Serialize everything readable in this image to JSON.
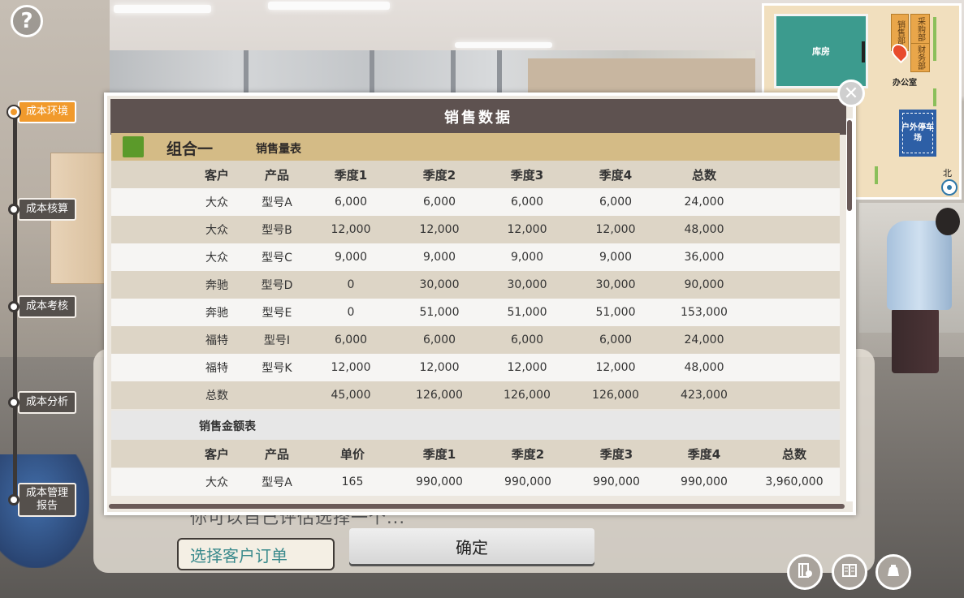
{
  "help": {
    "icon": "?"
  },
  "progress_steps": [
    {
      "label": "成本环境",
      "active": true
    },
    {
      "label": "成本核算",
      "active": false
    },
    {
      "label": "成本考核",
      "active": false
    },
    {
      "label": "成本分析",
      "active": false
    },
    {
      "label_line1": "成本管理",
      "label_line2": "报告",
      "active": false
    }
  ],
  "minimap": {
    "storage": "库房",
    "sales_dept": "销售部",
    "purchase_dept": "采购部",
    "finance_dept": "财务部",
    "office": "办公室",
    "parking": "户外停车场",
    "north": "北"
  },
  "modal": {
    "title": "销售数据",
    "close_icon": "✕",
    "group_name": "组合一",
    "group_color": "#5b9a2a",
    "volume_table": {
      "title": "销售量表",
      "headers": [
        "客户",
        "产品",
        "季度1",
        "季度2",
        "季度3",
        "季度4",
        "总数"
      ],
      "rows": [
        [
          "大众",
          "型号A",
          "6,000",
          "6,000",
          "6,000",
          "6,000",
          "24,000"
        ],
        [
          "大众",
          "型号B",
          "12,000",
          "12,000",
          "12,000",
          "12,000",
          "48,000"
        ],
        [
          "大众",
          "型号C",
          "9,000",
          "9,000",
          "9,000",
          "9,000",
          "36,000"
        ],
        [
          "奔驰",
          "型号D",
          "0",
          "30,000",
          "30,000",
          "30,000",
          "90,000"
        ],
        [
          "奔驰",
          "型号E",
          "0",
          "51,000",
          "51,000",
          "51,000",
          "153,000"
        ],
        [
          "福特",
          "型号I",
          "6,000",
          "6,000",
          "6,000",
          "6,000",
          "24,000"
        ],
        [
          "福特",
          "型号K",
          "12,000",
          "12,000",
          "12,000",
          "12,000",
          "48,000"
        ]
      ],
      "total_row": [
        "总数",
        "",
        "45,000",
        "126,000",
        "126,000",
        "126,000",
        "423,000"
      ]
    },
    "amount_table": {
      "title": "销售金额表",
      "headers": [
        "客户",
        "产品",
        "单价",
        "季度1",
        "季度2",
        "季度3",
        "季度4",
        "总数"
      ],
      "rows": [
        [
          "大众",
          "型号A",
          "165",
          "990,000",
          "990,000",
          "990,000",
          "990,000",
          "3,960,000"
        ]
      ]
    }
  },
  "dialogue": {
    "partial_text": "你可以自己评估选择一个...",
    "choice_label": "选择客户订单",
    "confirm_label": "确定"
  },
  "bottom_buttons": [
    {
      "name": "notebook-icon"
    },
    {
      "name": "book-icon"
    },
    {
      "name": "bag-icon"
    }
  ],
  "colors": {
    "accent": "#f19a2c",
    "header_bg": "#5e5250",
    "group_bar": "#d4bb86"
  }
}
